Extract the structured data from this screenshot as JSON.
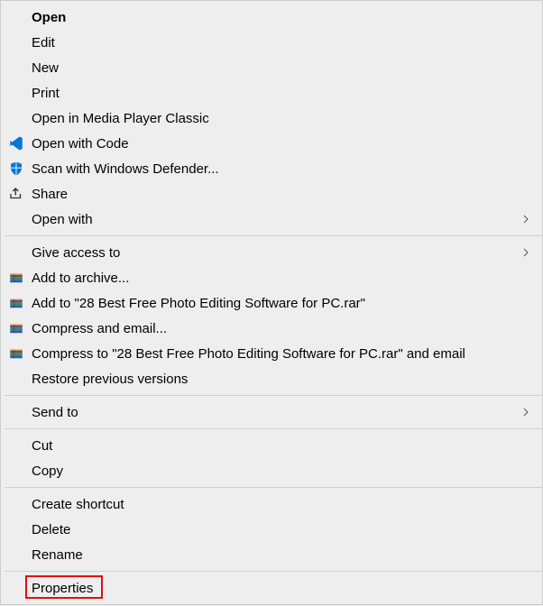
{
  "menu": {
    "items": [
      {
        "label": "Open",
        "bold": true,
        "icon": null,
        "submenu": false
      },
      {
        "label": "Edit",
        "icon": null,
        "submenu": false
      },
      {
        "label": "New",
        "icon": null,
        "submenu": false
      },
      {
        "label": "Print",
        "icon": null,
        "submenu": false
      },
      {
        "label": "Open in Media Player Classic",
        "icon": null,
        "submenu": false
      },
      {
        "label": "Open with Code",
        "icon": "vscode",
        "submenu": false
      },
      {
        "label": "Scan with Windows Defender...",
        "icon": "defender",
        "submenu": false
      },
      {
        "label": "Share",
        "icon": "share",
        "submenu": false
      },
      {
        "label": "Open with",
        "icon": null,
        "submenu": true
      },
      {
        "sep": true
      },
      {
        "label": "Give access to",
        "icon": null,
        "submenu": true
      },
      {
        "label": "Add to archive...",
        "icon": "winrar",
        "submenu": false
      },
      {
        "label": "Add to \"28 Best Free Photo Editing Software for PC.rar\"",
        "icon": "winrar",
        "submenu": false
      },
      {
        "label": "Compress and email...",
        "icon": "winrar",
        "submenu": false
      },
      {
        "label": "Compress to \"28 Best Free Photo Editing Software for PC.rar\" and email",
        "icon": "winrar",
        "submenu": false
      },
      {
        "label": "Restore previous versions",
        "icon": null,
        "submenu": false
      },
      {
        "sep": true
      },
      {
        "label": "Send to",
        "icon": null,
        "submenu": true
      },
      {
        "sep": true
      },
      {
        "label": "Cut",
        "icon": null,
        "submenu": false
      },
      {
        "label": "Copy",
        "icon": null,
        "submenu": false
      },
      {
        "sep": true
      },
      {
        "label": "Create shortcut",
        "icon": null,
        "submenu": false
      },
      {
        "label": "Delete",
        "icon": null,
        "submenu": false
      },
      {
        "label": "Rename",
        "icon": null,
        "submenu": false
      },
      {
        "sep": true
      },
      {
        "label": "Properties",
        "icon": null,
        "submenu": false,
        "highlighted": true
      }
    ]
  }
}
